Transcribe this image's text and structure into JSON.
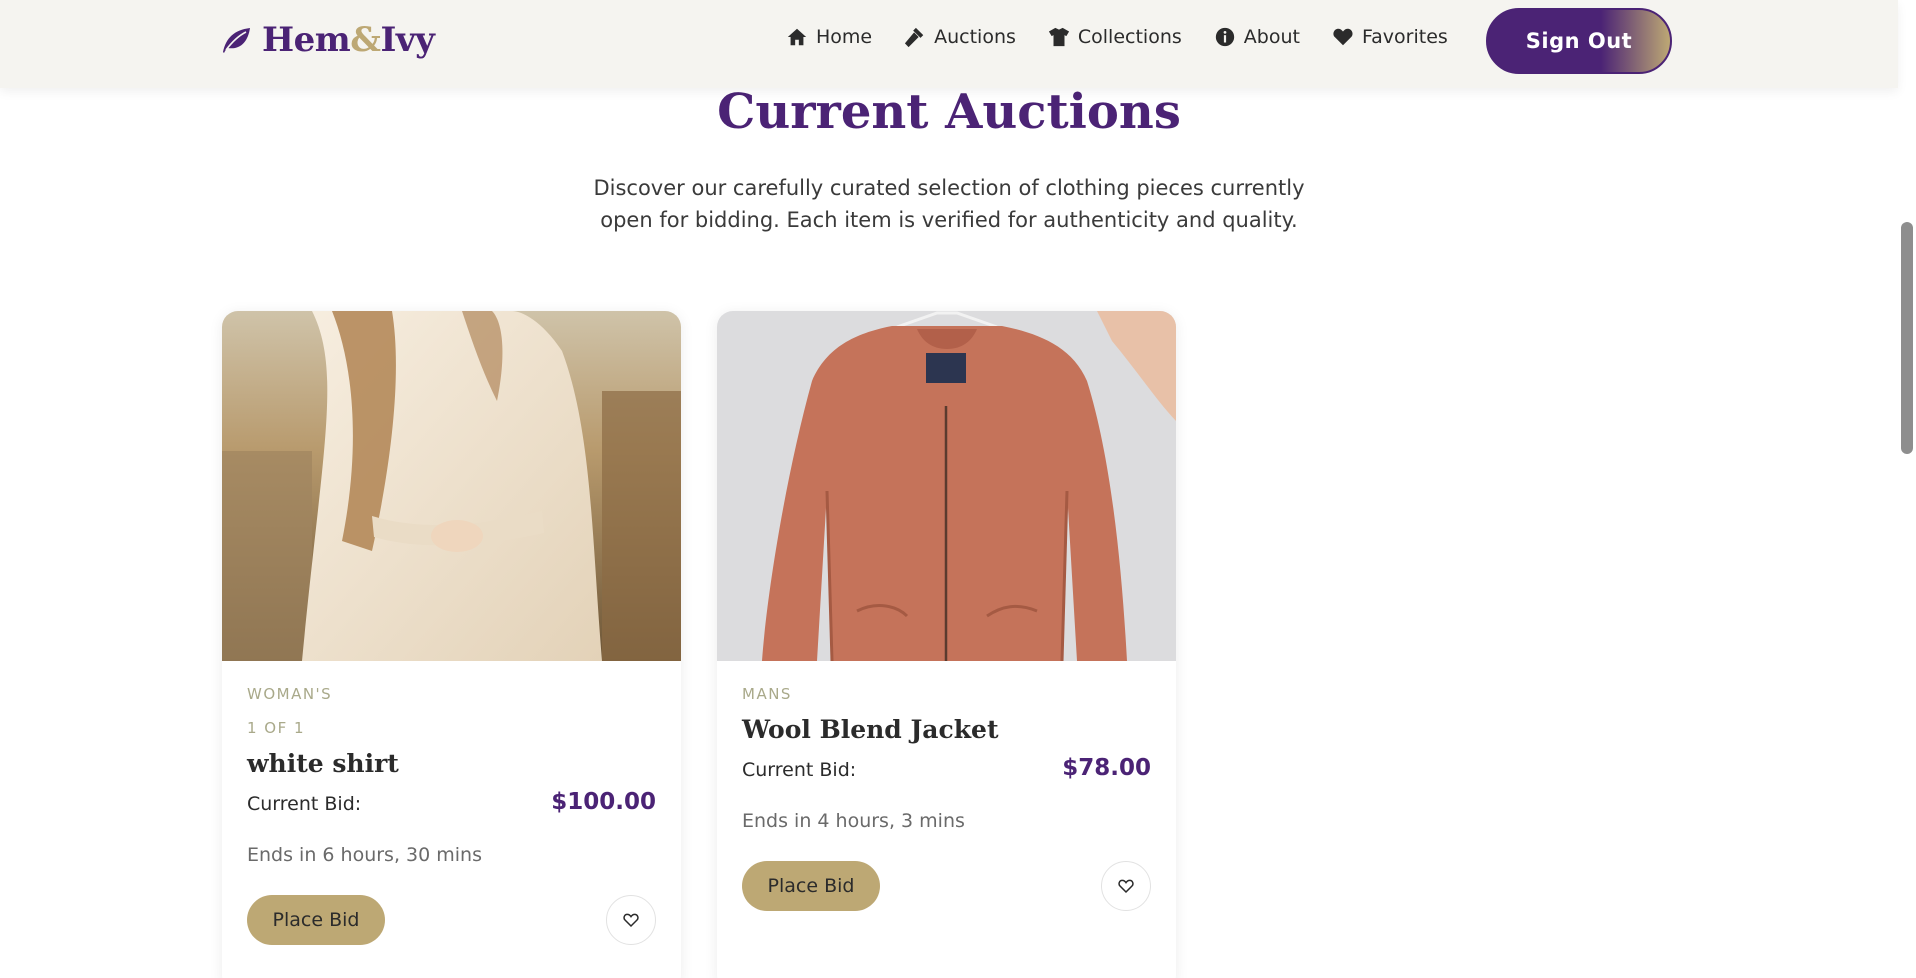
{
  "brand": {
    "name_part1": "Hem",
    "name_amp": "&",
    "name_part2": "Ivy"
  },
  "nav": [
    {
      "label": "Home",
      "icon": "home-icon"
    },
    {
      "label": "Auctions",
      "icon": "gavel-icon"
    },
    {
      "label": "Collections",
      "icon": "shirt-icon"
    },
    {
      "label": "About",
      "icon": "info-icon"
    },
    {
      "label": "Favorites",
      "icon": "heart-icon"
    }
  ],
  "signout_label": "Sign Out",
  "page": {
    "title": "Current Auctions",
    "description": "Discover our carefully curated selection of clothing pieces currently open for bidding. Each item is verified for authenticity and quality."
  },
  "cards": [
    {
      "category": "WOMAN'S",
      "counter": "1 OF 1",
      "title": "white shirt",
      "bid_label": "Current Bid:",
      "bid_value": "$100.00",
      "ends": "Ends in 6 hours, 30 mins",
      "button": "Place Bid",
      "image": "woman-white-shirt-photo"
    },
    {
      "category": "MANS",
      "title": "Wool Blend Jacket",
      "bid_label": "Current Bid:",
      "bid_value": "$78.00",
      "ends": "Ends in 4 hours, 3 mins",
      "button": "Place Bid",
      "image": "orange-jacket-on-hanger-photo"
    }
  ],
  "colors": {
    "brand_purple": "#4b2375",
    "accent_gold": "#bda874",
    "category_text": "#a9a98a",
    "header_bg": "#f5f4f0"
  }
}
